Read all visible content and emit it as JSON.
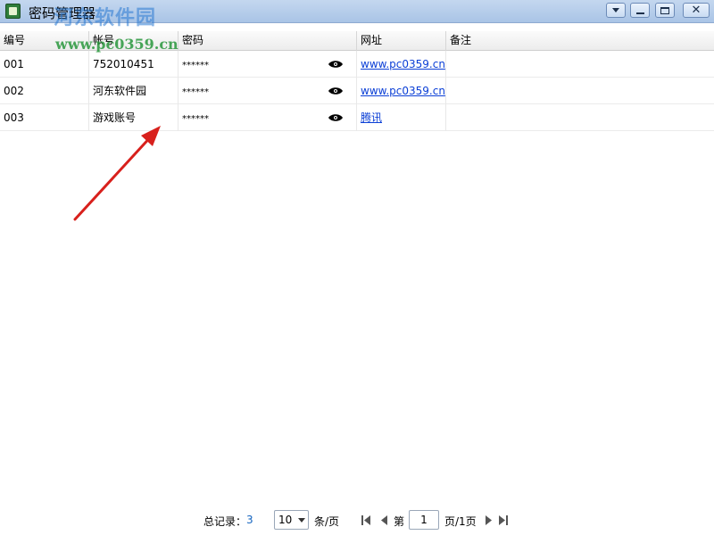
{
  "window": {
    "title": "密码管理器",
    "watermark": "河东软件园",
    "watermark_url": "www.pc0359.cn",
    "buttons": {
      "menu": "menu-caret",
      "minimize": "minimize",
      "maximize": "maximize",
      "close": "✕"
    }
  },
  "table": {
    "columns": [
      "编号",
      "帐号",
      "密码",
      "网址",
      "备注"
    ],
    "rows": [
      {
        "id": "001",
        "account": "752010451",
        "password": "******",
        "url": "www.pc0359.cn",
        "note": ""
      },
      {
        "id": "002",
        "account": "河东软件园",
        "password": "******",
        "url": "www.pc0359.cn",
        "note": ""
      },
      {
        "id": "003",
        "account": "游戏账号",
        "password": "******",
        "url": "腾讯",
        "note": ""
      }
    ]
  },
  "pager": {
    "total_label": "总记录：",
    "total_value": "3",
    "page_size": "10",
    "per_page_label": "条/页",
    "page_prefix": "第",
    "current_page": "1",
    "page_suffix": "页/1页"
  },
  "colors": {
    "link": "#0b3fd6",
    "total_value": "#1565c0",
    "arrow": "#d8201c",
    "titlebar": "#b9cfeb"
  }
}
